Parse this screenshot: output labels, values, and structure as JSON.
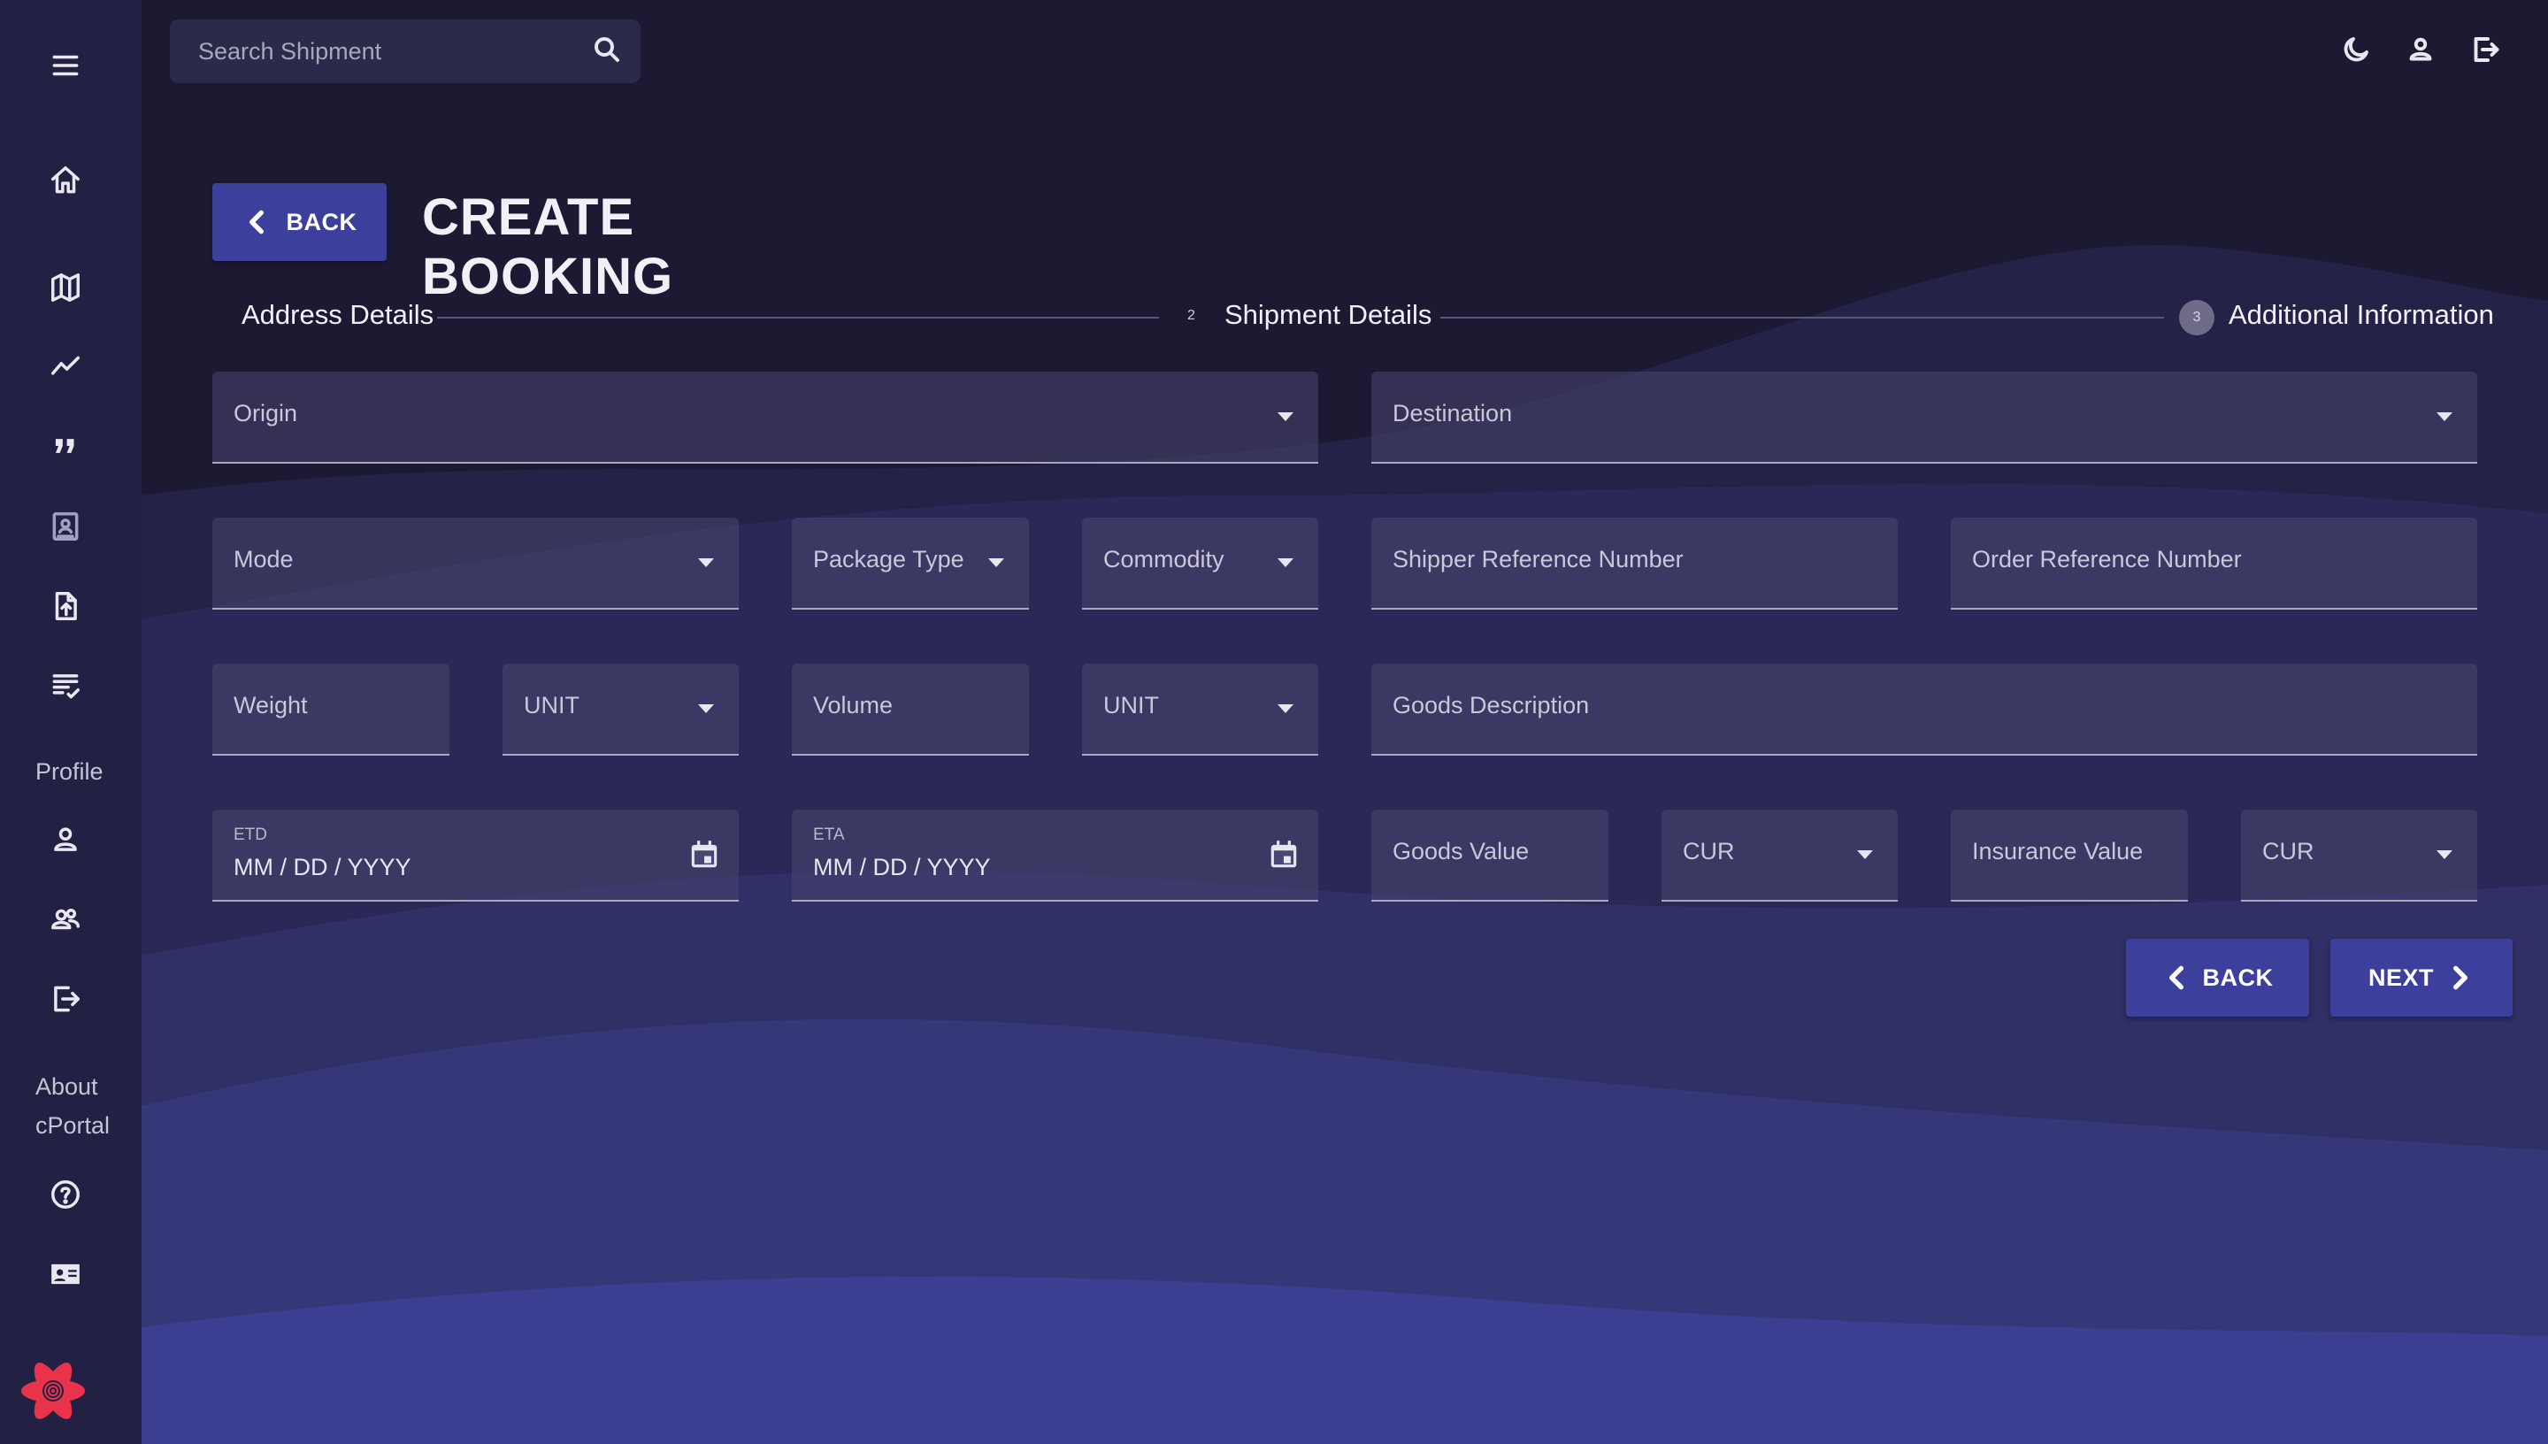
{
  "search": {
    "placeholder": "Search Shipment",
    "icon": "search-icon"
  },
  "topbar": {
    "icons": [
      "moon-icon",
      "user-icon",
      "logout-icon"
    ]
  },
  "sidebar": {
    "icons": [
      "menu-icon",
      "home-icon",
      "map-icon",
      "trending-icon",
      "quote-icon",
      "contact-card-icon",
      "file-upload-icon",
      "checklist-icon"
    ],
    "profile_label": "Profile",
    "profile_icons": [
      "person-icon",
      "people-icon",
      "logout-icon"
    ],
    "about_label_1": "About",
    "about_label_2": "cPortal",
    "about_icons": [
      "help-icon",
      "id-card-icon"
    ]
  },
  "header": {
    "back_label": "BACK",
    "title": "CREATE BOOKING"
  },
  "stepper": {
    "steps": [
      {
        "label": "Address Details"
      },
      {
        "number": "2",
        "label": "Shipment Details"
      },
      {
        "number": "3",
        "label": "Additional Information"
      }
    ]
  },
  "form": {
    "origin": "Origin",
    "destination": "Destination",
    "mode": "Mode",
    "package_type": "Package Type",
    "commodity": "Commodity",
    "shipper_ref": "Shipper Reference Number",
    "order_ref": "Order Reference Number",
    "weight": "Weight",
    "weight_unit": "UNIT",
    "volume": "Volume",
    "volume_unit": "UNIT",
    "goods_description": "Goods Description",
    "etd_label": "ETD",
    "etd_value": "MM / DD / YYYY",
    "eta_label": "ETA",
    "eta_value": "MM / DD / YYYY",
    "goods_value": "Goods Value",
    "goods_currency": "CUR",
    "insurance_value": "Insurance Value",
    "insurance_currency": "CUR"
  },
  "actions": {
    "back_label": "BACK",
    "next_label": "NEXT"
  },
  "colors": {
    "background": "#1c1a33",
    "sidebar": "#232143",
    "accent": "#3d3f9c",
    "wave": "#3b3e8e",
    "logo": "#e8334a"
  }
}
